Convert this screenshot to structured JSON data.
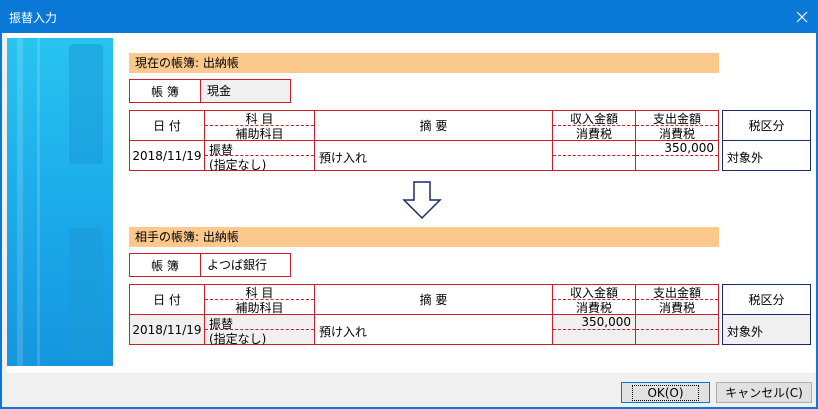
{
  "window": {
    "title": "振替入力"
  },
  "sections": [
    {
      "header": "現在の帳簿: 出納帳",
      "book_label": "帳 簿",
      "book_value": "現金",
      "headers": {
        "date": "日 付",
        "account": "科 目",
        "sub_account": "補助科目",
        "summary": "摘 要",
        "income": "収入金額",
        "income_tax": "消費税",
        "expense": "支出金額",
        "expense_tax": "消費税",
        "tax_class": "税区分"
      },
      "row": {
        "date": "2018/11/19",
        "account": "振替",
        "sub_account": "(指定なし)",
        "summary": "預け入れ",
        "income": "",
        "income_tax": "",
        "expense": "350,000",
        "expense_tax": "",
        "tax_class": "対象外"
      }
    },
    {
      "header": "相手の帳簿: 出納帳",
      "book_label": "帳 簿",
      "book_value": "よつば銀行",
      "headers": {
        "date": "日 付",
        "account": "科 目",
        "sub_account": "補助科目",
        "summary": "摘 要",
        "income": "収入金額",
        "income_tax": "消費税",
        "expense": "支出金額",
        "expense_tax": "消費税",
        "tax_class": "税区分"
      },
      "row": {
        "date": "2018/11/19",
        "account": "振替",
        "sub_account": "(指定なし)",
        "summary": "預け入れ",
        "income": "350,000",
        "income_tax": "",
        "expense": "",
        "expense_tax": "",
        "tax_class": "対象外"
      }
    }
  ],
  "buttons": {
    "ok": "OK(O)",
    "cancel": "キャンセル(C)"
  },
  "colors": {
    "titlebar": "#0a78d7",
    "header_band": "#fcc98d",
    "grid_border": "#cc1f2a",
    "tax_border": "#1b2a6b"
  }
}
